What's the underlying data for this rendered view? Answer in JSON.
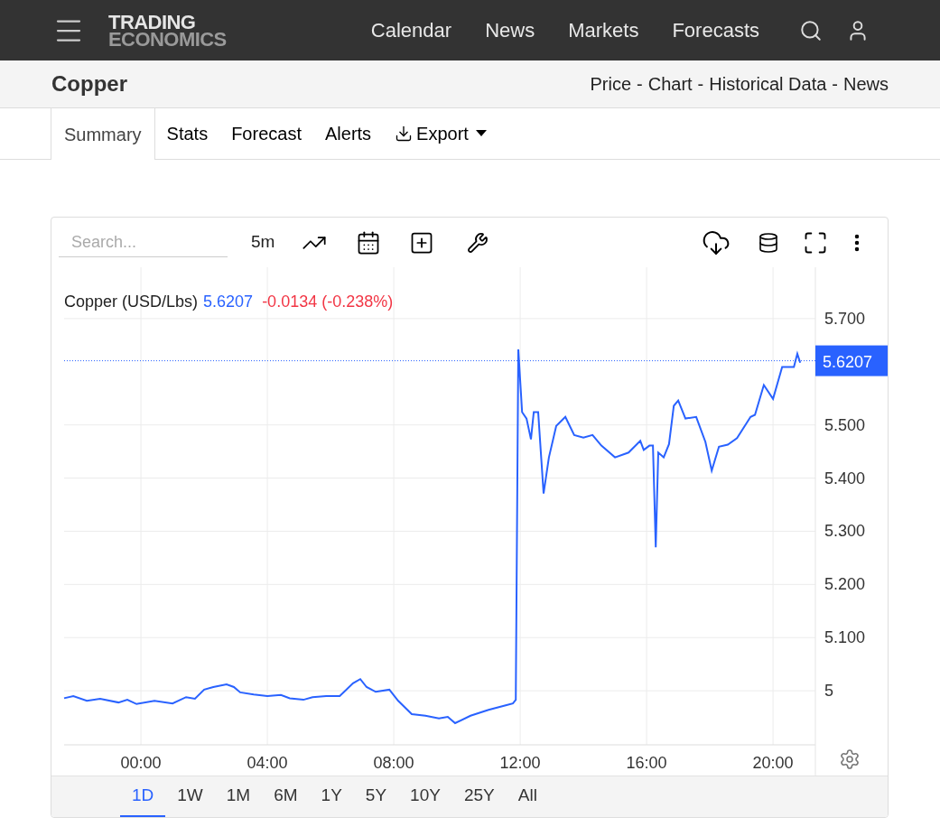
{
  "header": {
    "logo": {
      "line_1": "TRADING",
      "line_2": "ECONOMICS"
    },
    "nav": [
      "Calendar",
      "News",
      "Markets",
      "Forecasts"
    ]
  },
  "title_bar": {
    "title": "Copper",
    "links": [
      "Price",
      "Chart",
      "Historical Data",
      "News"
    ],
    "separator": "-"
  },
  "tabs": [
    {
      "label": "Summary",
      "selected": true,
      "kind": "tab"
    },
    {
      "label": "Stats",
      "selected": false,
      "kind": "tab"
    },
    {
      "label": "Forecast",
      "selected": false,
      "kind": "tab"
    },
    {
      "label": "Alerts",
      "selected": false,
      "kind": "tab"
    },
    {
      "label": "Export",
      "selected": false,
      "kind": "dropdown"
    }
  ],
  "chart_widget": {
    "search": {
      "placeholder": "Search..."
    },
    "interval": "5m",
    "legend": {
      "price": "5.6207",
      "change": "-0.0134 (-0.238%)"
    },
    "chart_data": {
      "type": "line",
      "grid": true,
      "xlim": [
        -2.43,
        21.34
      ],
      "ylim": [
        4.8983,
        5.7966
      ],
      "xticks": [
        {
          "value": 0,
          "label": "00:00"
        },
        {
          "value": 4,
          "label": "04:00"
        },
        {
          "value": 8,
          "label": "08:00"
        },
        {
          "value": 12,
          "label": "12:00"
        },
        {
          "value": 16,
          "label": "16:00"
        },
        {
          "value": 20,
          "label": "20:00"
        }
      ],
      "yticks": [
        {
          "value": 5,
          "label": "5"
        },
        {
          "value": 5.1,
          "label": "5.100"
        },
        {
          "value": 5.2,
          "label": "5.200"
        },
        {
          "value": 5.3,
          "label": "5.300"
        },
        {
          "value": 5.4,
          "label": "5.400"
        },
        {
          "value": 5.5,
          "label": "5.500"
        },
        {
          "value": 5.7,
          "label": "5.700"
        }
      ],
      "x": [
        -2.43,
        -2.14,
        -1.71,
        -1.29,
        -0.71,
        -0.43,
        -0.14,
        0.43,
        1.0,
        1.43,
        1.71,
        2.0,
        2.29,
        2.71,
        2.94,
        3.14,
        3.57,
        4.0,
        4.43,
        4.71,
        5.14,
        5.43,
        5.86,
        6.29,
        6.71,
        6.94,
        7.14,
        7.43,
        7.86,
        8.14,
        8.57,
        9.0,
        9.43,
        9.71,
        9.94,
        10.43,
        11.0,
        11.57,
        11.77,
        11.86,
        11.94,
        12.06,
        12.2,
        12.34,
        12.43,
        12.57,
        12.74,
        12.91,
        13.14,
        13.43,
        13.71,
        14.0,
        14.29,
        14.57,
        15.0,
        15.43,
        15.8,
        15.91,
        16.09,
        16.2,
        16.29,
        16.37,
        16.54,
        16.71,
        16.86,
        17.0,
        17.23,
        17.57,
        17.86,
        18.06,
        18.29,
        18.57,
        18.86,
        19.29,
        19.43,
        19.71,
        20.0,
        20.29,
        20.49,
        20.66,
        20.77,
        20.86
      ],
      "series": [
        {
          "name": "Copper (USD/Lbs)",
          "color": "#2962ff",
          "values": [
            4.986,
            4.99,
            4.981,
            4.985,
            4.978,
            4.983,
            4.975,
            4.981,
            4.976,
            4.988,
            4.985,
            5.002,
            5.007,
            5.012,
            5.007,
            4.997,
            4.993,
            4.99,
            4.992,
            4.986,
            4.983,
            4.988,
            4.99,
            4.99,
            5.014,
            5.022,
            5.007,
            4.998,
            5.002,
            4.981,
            4.956,
            4.953,
            4.948,
            4.951,
            4.939,
            4.953,
            4.964,
            4.973,
            4.976,
            4.983,
            5.642,
            5.524,
            5.512,
            5.473,
            5.524,
            5.524,
            5.371,
            5.439,
            5.498,
            5.515,
            5.481,
            5.476,
            5.481,
            5.461,
            5.439,
            5.448,
            5.47,
            5.453,
            5.461,
            5.461,
            5.27,
            5.448,
            5.439,
            5.464,
            5.536,
            5.546,
            5.512,
            5.515,
            5.468,
            5.414,
            5.459,
            5.463,
            5.475,
            5.515,
            5.519,
            5.575,
            5.549,
            5.609,
            5.609,
            5.609,
            5.634,
            5.617
          ]
        }
      ],
      "ref_lines": [
        {
          "axis": "y",
          "value": 5.6207,
          "label": "5.6207",
          "color": "#2962ff"
        }
      ]
    },
    "ranges": [
      {
        "label": "1D",
        "selected": true
      },
      {
        "label": "1W",
        "selected": false
      },
      {
        "label": "1M",
        "selected": false
      },
      {
        "label": "6M",
        "selected": false
      },
      {
        "label": "1Y",
        "selected": false
      },
      {
        "label": "5Y",
        "selected": false
      },
      {
        "label": "10Y",
        "selected": false
      },
      {
        "label": "25Y",
        "selected": false
      },
      {
        "label": "All",
        "selected": false
      }
    ]
  }
}
